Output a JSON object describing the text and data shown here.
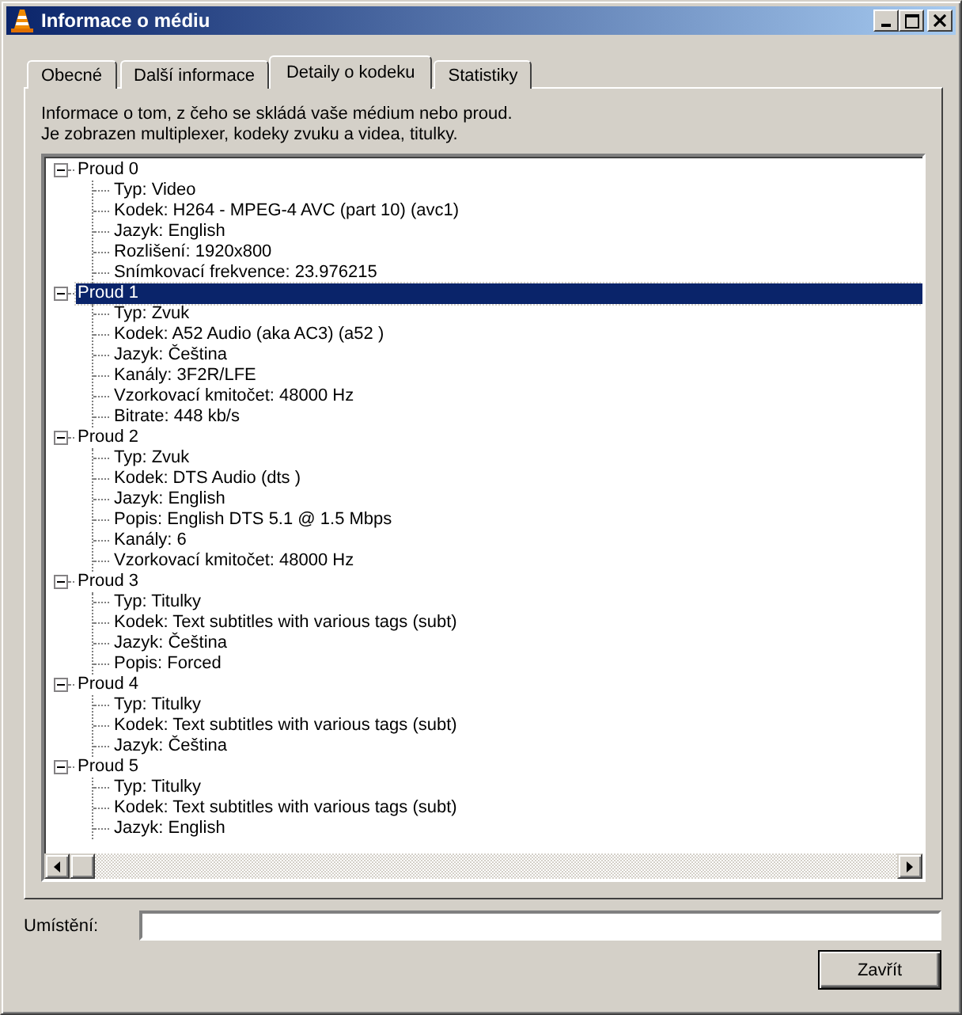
{
  "window": {
    "title": "Informace o médiu"
  },
  "tabs": [
    {
      "label": "Obecné",
      "selected": false
    },
    {
      "label": "Další informace",
      "selected": false
    },
    {
      "label": "Detaily o kodeku",
      "selected": true
    },
    {
      "label": "Statistiky",
      "selected": false
    }
  ],
  "description": [
    "Informace o tom, z čeho se skládá vaše médium nebo proud.",
    "Je zobrazen multiplexer, kodeky zvuku a videa, titulky."
  ],
  "tree": [
    {
      "label": "Proud 0",
      "expanded": true,
      "selected": false,
      "children": [
        "Typ: Video",
        "Kodek: H264 - MPEG-4 AVC (part 10) (avc1)",
        "Jazyk: English",
        "Rozlišení: 1920x800",
        "Snímkovací frekvence: 23.976215"
      ]
    },
    {
      "label": "Proud 1",
      "expanded": true,
      "selected": true,
      "children": [
        "Typ: Zvuk",
        "Kodek: A52 Audio (aka AC3) (a52 )",
        "Jazyk: Čeština",
        "Kanály: 3F2R/LFE",
        "Vzorkovací kmitočet: 48000 Hz",
        "Bitrate: 448 kb/s"
      ]
    },
    {
      "label": "Proud 2",
      "expanded": true,
      "selected": false,
      "children": [
        "Typ: Zvuk",
        "Kodek: DTS Audio (dts )",
        "Jazyk: English",
        "Popis: English DTS 5.1 @ 1.5 Mbps",
        "Kanály: 6",
        "Vzorkovací kmitočet: 48000 Hz"
      ]
    },
    {
      "label": "Proud 3",
      "expanded": true,
      "selected": false,
      "children": [
        "Typ: Titulky",
        "Kodek: Text subtitles with various tags (subt)",
        "Jazyk: Čeština",
        "Popis: Forced"
      ]
    },
    {
      "label": "Proud 4",
      "expanded": true,
      "selected": false,
      "children": [
        "Typ: Titulky",
        "Kodek: Text subtitles with various tags (subt)",
        "Jazyk: Čeština"
      ]
    },
    {
      "label": "Proud 5",
      "expanded": true,
      "selected": false,
      "children": [
        "Typ: Titulky",
        "Kodek: Text subtitles with various tags (subt)",
        "Jazyk: English"
      ]
    }
  ],
  "location": {
    "label": "Umístění:"
  },
  "buttons": [
    "Zavřít"
  ]
}
